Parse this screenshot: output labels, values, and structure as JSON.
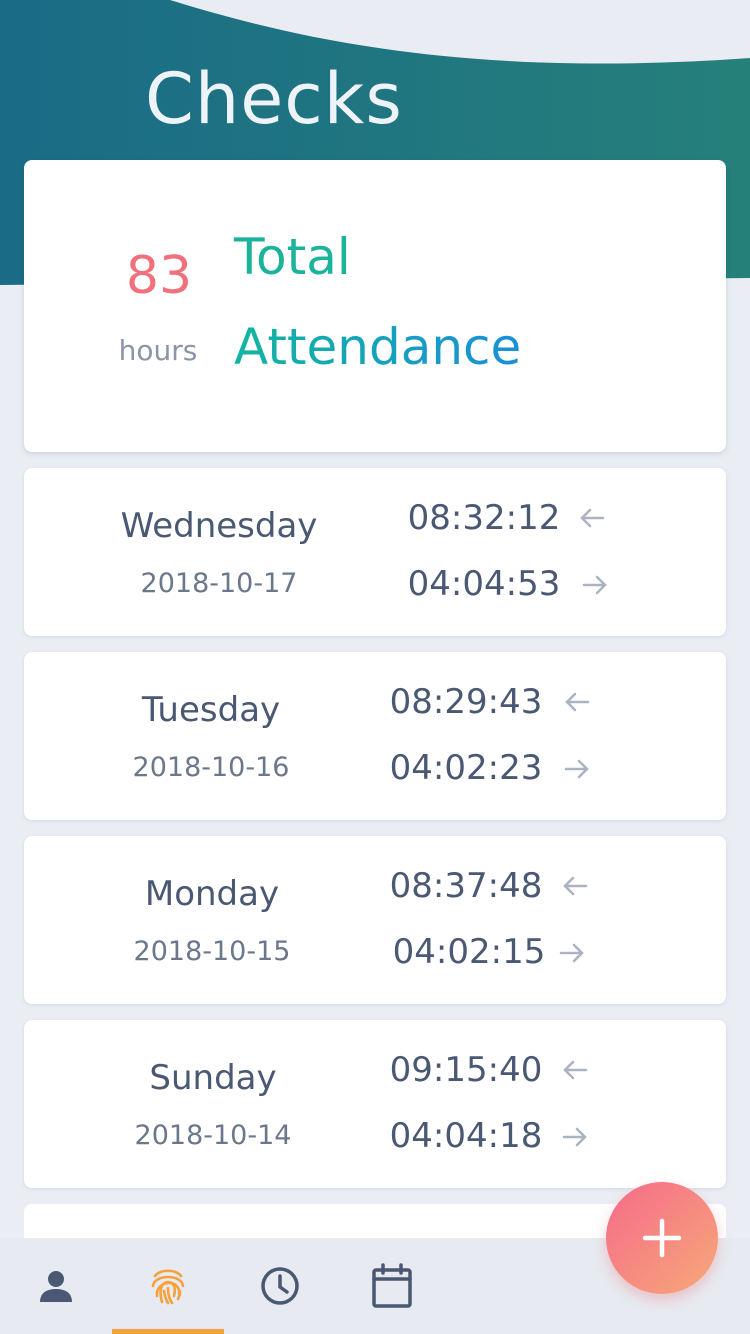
{
  "header": {
    "title": "Checks"
  },
  "summary": {
    "hours_value": "83",
    "hours_unit": "hours",
    "label_line1": "Total",
    "label_line2": "Attendance"
  },
  "checks": [
    {
      "day": "Wednesday",
      "date": "2018-10-17",
      "check_in": "08:32:12",
      "check_out": "04:04:53"
    },
    {
      "day": "Tuesday",
      "date": "2018-10-16",
      "check_in": "08:29:43",
      "check_out": "04:02:23"
    },
    {
      "day": "Monday",
      "date": "2018-10-15",
      "check_in": "08:37:48",
      "check_out": "04:02:15"
    },
    {
      "day": "Sunday",
      "date": "2018-10-14",
      "check_in": "09:15:40",
      "check_out": "04:04:18"
    }
  ],
  "tabs": [
    {
      "icon": "person-icon"
    },
    {
      "icon": "fingerprint-icon",
      "active": true
    },
    {
      "icon": "clock-icon"
    },
    {
      "icon": "calendar-icon"
    }
  ],
  "fab": {
    "icon": "plus-icon"
  },
  "colors": {
    "header_wave_start": "#1a6b86",
    "header_wave_end": "#26807a",
    "hours_value": "#f0707c",
    "total_label": "#1bb39a",
    "active_tab": "#f8a13a",
    "fab_start": "#f56a8a",
    "fab_end": "#f7a978"
  }
}
